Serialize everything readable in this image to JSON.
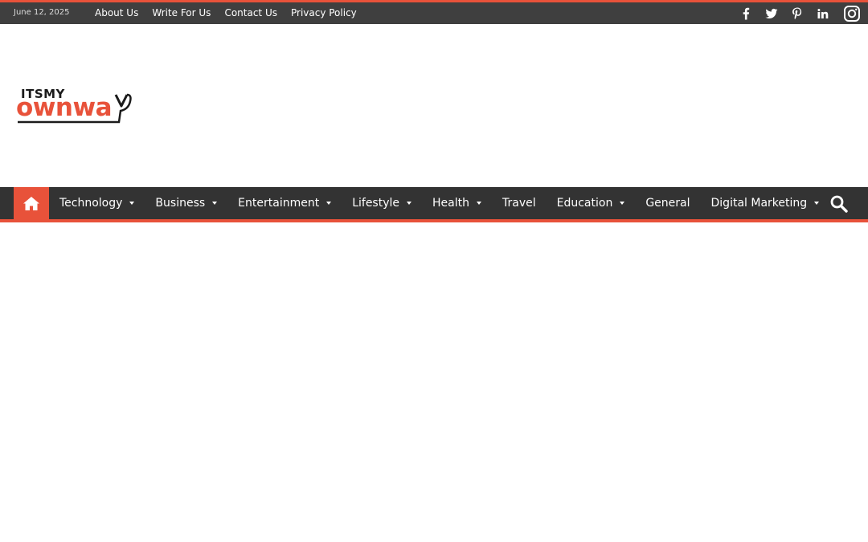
{
  "topbar": {
    "date": "June 12, 2025",
    "links": [
      "About Us",
      "Write For Us",
      "Contact Us",
      "Privacy Policy"
    ],
    "socials": [
      "facebook-icon",
      "twitter-icon",
      "pinterest-icon",
      "linkedin-icon",
      "instagram-icon"
    ]
  },
  "logo": {
    "top_text": "ITSMY",
    "main_text": "ownwa"
  },
  "nav": {
    "home_icon": "home-icon",
    "items": [
      {
        "label": "Technology",
        "dropdown": true
      },
      {
        "label": "Business",
        "dropdown": true
      },
      {
        "label": "Entertainment",
        "dropdown": true
      },
      {
        "label": "Lifestyle",
        "dropdown": true
      },
      {
        "label": "Health",
        "dropdown": true
      },
      {
        "label": "Travel",
        "dropdown": false
      },
      {
        "label": "Education",
        "dropdown": true
      },
      {
        "label": "General",
        "dropdown": false
      },
      {
        "label": "Digital Marketing",
        "dropdown": true
      }
    ],
    "search_icon": "search-icon"
  },
  "colors": {
    "accent": "#e8523a",
    "topbar_bg": "#3f3f3f",
    "nav_bg": "#333333"
  }
}
